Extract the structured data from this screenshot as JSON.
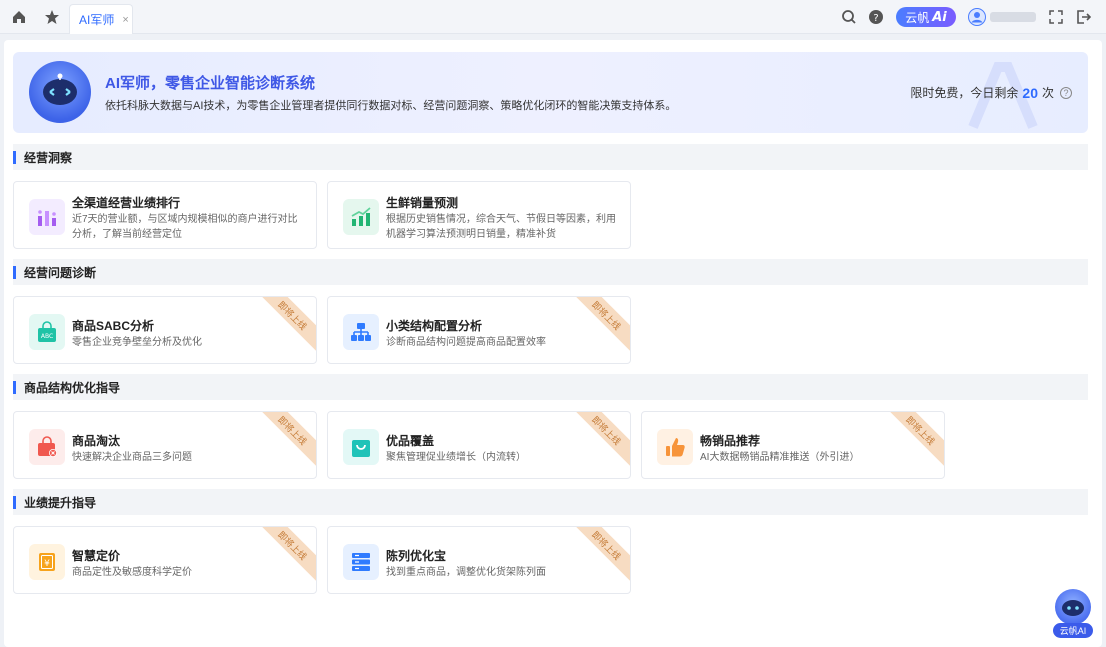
{
  "topbar": {
    "home_icon": "home-icon",
    "star_icon": "star-icon",
    "tab_label": "AI军师",
    "tab_close": "×",
    "search_icon": "search-icon",
    "help_icon": "help-icon",
    "ai_pill_text": "云帆",
    "ai_pill_mark": "Ai",
    "avatar_icon": "avatar-icon",
    "fullscreen_icon": "fullscreen-icon",
    "logout_icon": "logout-icon"
  },
  "banner": {
    "title": "AI军师，零售企业智能诊断系统",
    "desc": "依托科脉大数据与AI技术，为零售企业管理者提供同行数据对标、经营问题洞察、策略优化闭环的智能决策支持体系。",
    "quota_prefix": "限时免费，今日剩余",
    "quota_num": "20",
    "quota_suffix": "次",
    "help": "?"
  },
  "ribbon_text": "即将上线",
  "sections": [
    {
      "title": "经营洞察",
      "cards": [
        {
          "title": "全渠道经营业绩排行",
          "desc": "近7天的营业额，与区域内规模相似的商户进行对比分析，了解当前经营定位",
          "icon": "bar-chart-icon",
          "color": "#a45cf0",
          "bg": "#f3ecff",
          "ribbon": false
        },
        {
          "title": "生鲜销量预测",
          "desc": "根据历史销售情况，综合天气、节假日等因素，利用机器学习算法预测明日销量，精准补货",
          "icon": "trend-chart-icon",
          "color": "#22b573",
          "bg": "#e5f7ee",
          "ribbon": false
        }
      ]
    },
    {
      "title": "经营问题诊断",
      "cards": [
        {
          "title": "商品SABC分析",
          "desc": "零售企业竞争壁垒分析及优化",
          "icon": "abc-bag-icon",
          "color": "#1fc3a6",
          "bg": "#e3f8f3",
          "ribbon": true
        },
        {
          "title": "小类结构配置分析",
          "desc": "诊断商品结构问题提高商品配置效率",
          "icon": "hierarchy-icon",
          "color": "#2f7bff",
          "bg": "#e6f0ff",
          "ribbon": true
        }
      ]
    },
    {
      "title": "商品结构优化指导",
      "cards": [
        {
          "title": "商品淘汰",
          "desc": "快速解决企业商品三多问题",
          "icon": "bag-remove-icon",
          "color": "#f0584f",
          "bg": "#fdeceb",
          "ribbon": true
        },
        {
          "title": "优品覆盖",
          "desc": "聚焦管理促业绩增长（内流转）",
          "icon": "shopping-bag-icon",
          "color": "#1fc3b8",
          "bg": "#e3f8f6",
          "ribbon": true
        },
        {
          "title": "畅销品推荐",
          "desc": "AI大数据畅销品精准推送（外引进）",
          "icon": "thumbs-up-icon",
          "color": "#f7943a",
          "bg": "#fff1e3",
          "ribbon": true
        }
      ]
    },
    {
      "title": "业绩提升指导",
      "cards": [
        {
          "title": "智慧定价",
          "desc": "商品定性及敏感度科学定价",
          "icon": "price-tag-icon",
          "color": "#f7a31c",
          "bg": "#fff3df",
          "ribbon": true
        },
        {
          "title": "陈列优化宝",
          "desc": "找到重点商品，调整优化货架陈列面",
          "icon": "server-rack-icon",
          "color": "#2f7bff",
          "bg": "#e6f0ff",
          "ribbon": true
        }
      ]
    }
  ],
  "float_ai": {
    "label": "云帆AI",
    "icon": "robot-avatar-icon"
  }
}
